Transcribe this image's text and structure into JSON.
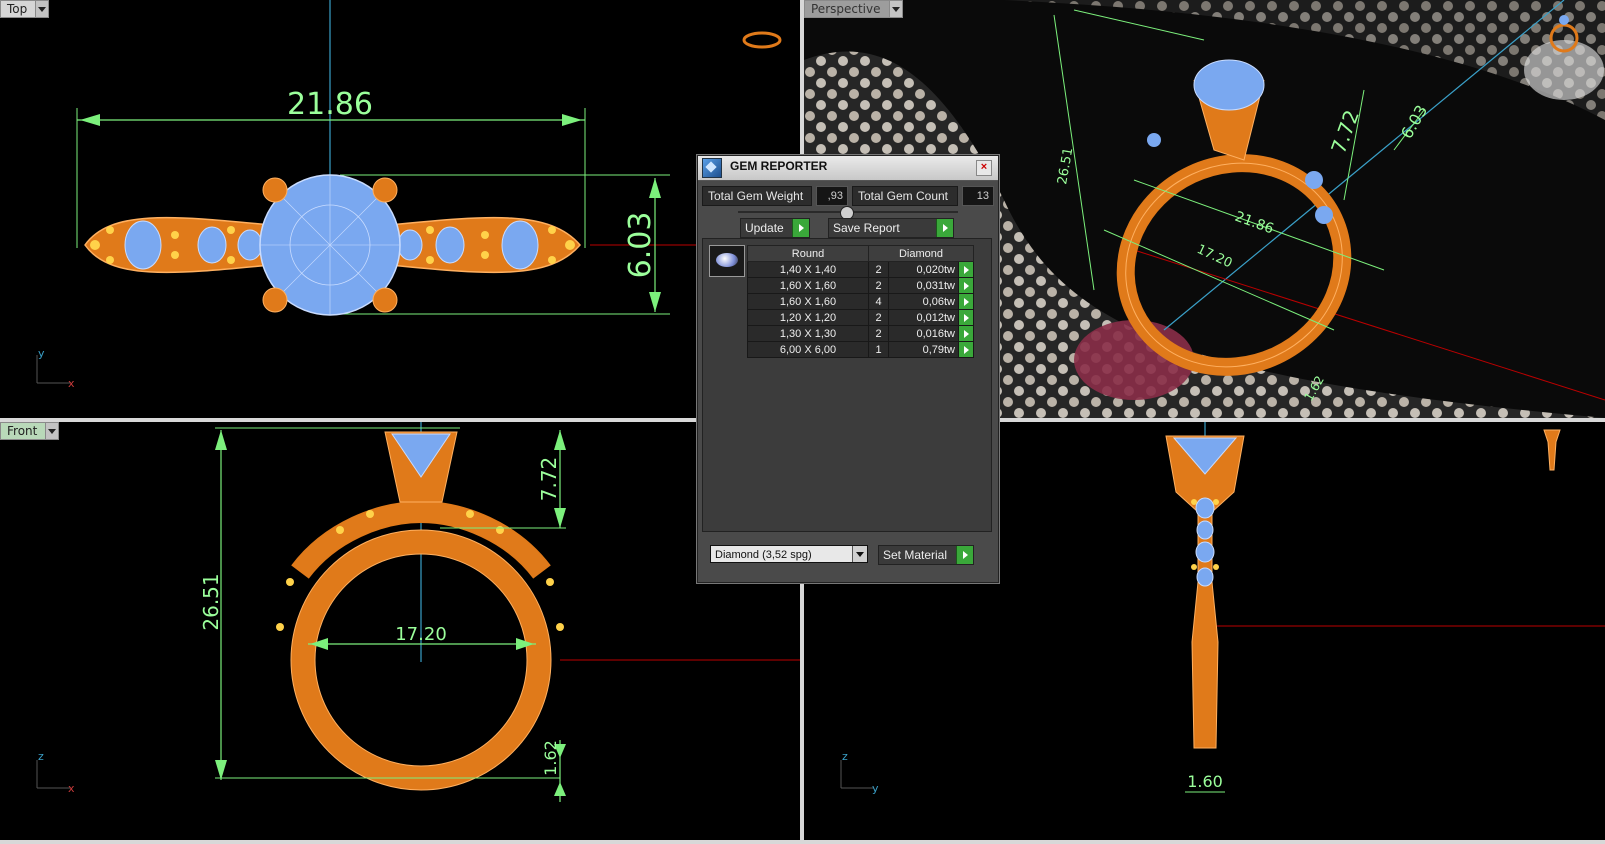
{
  "viewports": {
    "top": {
      "label": "Top",
      "dim_width": "21.86",
      "dim_height": "6.03",
      "axis_v": "y",
      "axis_h": "x"
    },
    "perspective": {
      "label": "Perspective",
      "dim_a": "7.72",
      "dim_b": "6.03",
      "dim_c": "21.86",
      "dim_d": "17.20",
      "dim_e": "26.51",
      "dim_f": "1.62"
    },
    "front": {
      "label": "Front",
      "dim_height": "26.51",
      "dim_top": "7.72",
      "dim_inner": "17.20",
      "dim_band": "1.62",
      "axis_v": "z",
      "axis_h": "x"
    },
    "right": {
      "dim_band": "1.60",
      "axis_v": "z",
      "axis_h": "y"
    }
  },
  "gem_reporter": {
    "title": "GEM REPORTER",
    "close": "×",
    "total_weight_label": "Total Gem Weight",
    "total_weight_value": ",93",
    "total_count_label": "Total Gem Count",
    "total_count_value": "13",
    "update_label": "Update",
    "save_report_label": "Save Report",
    "table_headers": [
      "Round",
      "Diamond"
    ],
    "rows": [
      {
        "size": "1,40 X 1,40",
        "count": "2",
        "weight": "0,020tw"
      },
      {
        "size": "1,60 X 1,60",
        "count": "2",
        "weight": "0,031tw"
      },
      {
        "size": "1,60 X 1,60",
        "count": "4",
        "weight": "0,06tw"
      },
      {
        "size": "1,20 X 1,20",
        "count": "2",
        "weight": "0,012tw"
      },
      {
        "size": "1,30 X 1,30",
        "count": "2",
        "weight": "0,016tw"
      },
      {
        "size": "6,00 X 6,00",
        "count": "1",
        "weight": "0,79tw"
      }
    ],
    "material_value": "Diamond    (3,52 spg)",
    "set_material_label": "Set Material"
  }
}
